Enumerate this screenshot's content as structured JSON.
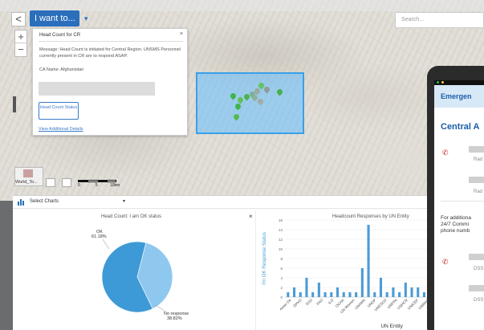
{
  "toolbar": {
    "back": "<",
    "i_want": "I want to...",
    "caret": "▾",
    "search_placeholder": "Search..."
  },
  "zoom": {
    "in": "+",
    "out": "−"
  },
  "map_labels": [],
  "popup": {
    "title": "Head Count for CR",
    "close": "×",
    "message": "Message: Head Count is initiated for Central Region. UNSMS Personnel currently present in CR are to respond ASAP.",
    "ca_name": "CA Name: Afghanistan",
    "button": "Head Count Status",
    "link": "View Additional Details"
  },
  "map_footer": {
    "basemap_label": "World_To...",
    "scale_labels": [
      "0",
      "5",
      "10km"
    ]
  },
  "charts_panel": {
    "select_label": "Select Charts",
    "caret": "▾",
    "close": "×"
  },
  "colors": {
    "accent": "#2a6ebc",
    "pie_main": "#3e9ad6",
    "pie_slice": "#8fc8ef",
    "bar": "#4b9bd5",
    "alert": "#c62828"
  },
  "chart_data": [
    {
      "type": "pie",
      "title": "Head Count: I am OK status",
      "slices": [
        {
          "label": "OK",
          "percent": 61.18,
          "display": "OK\n61.18%"
        },
        {
          "label": "No response",
          "percent": 38.82,
          "display": "No response\n38.82%"
        }
      ]
    },
    {
      "type": "bar",
      "title": "Headcount Responses by UN Entity",
      "xlabel": "UN Entity",
      "ylabel": "I'm OK Response Status",
      "ylim": [
        0,
        16
      ],
      "yticks": [
        0,
        2,
        4,
        6,
        8,
        10,
        12,
        14,
        16
      ],
      "categories": [
        "Asian De",
        "DPKO",
        "DSS",
        "FAO",
        "ILO",
        "OCHA",
        "UN Women",
        "UNAMA",
        "UNDP",
        "UNESCO",
        "UNFPA",
        "UNHCR",
        "UNICEF",
        "UNMAS"
      ],
      "series": [
        {
          "values": [
            1,
            2,
            1,
            4,
            1,
            3,
            1,
            1,
            2,
            1,
            1,
            1,
            6,
            15,
            1,
            4,
            1,
            2,
            1,
            3,
            2,
            2,
            1,
            3
          ]
        }
      ]
    }
  ],
  "phone": {
    "header": "Emergen",
    "region": "Central A",
    "contacts": [
      "Rad",
      "Rad",
      "DSS",
      "DSS"
    ],
    "info": [
      "For additiona",
      "24/7 Commi",
      "phone numb"
    ]
  }
}
